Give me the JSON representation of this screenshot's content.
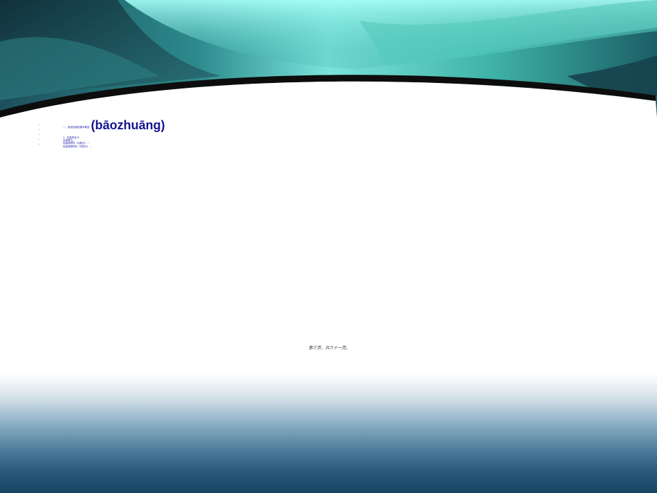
{
  "slide": {
    "title_prefix": "一、食品包装的基本概念",
    "title_main": "(bāozhuāng)",
    "bullets": [
      "1、包装的含义：",
      "包装是为...",
      "包装按照性（功能分）...",
      "包装按照材料（材质分）..."
    ],
    "footer": "第三页，共六十一页。"
  },
  "colors": {
    "title": "#141490",
    "teal_dark": "#1f6f7a",
    "teal_light": "#8ff0ea",
    "curve_band": "#0d0d0d"
  }
}
